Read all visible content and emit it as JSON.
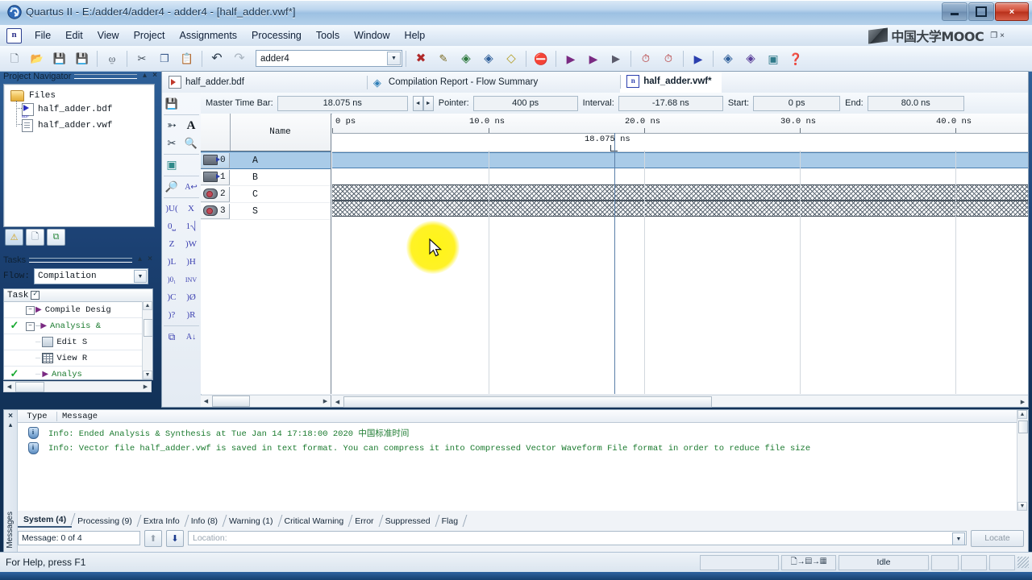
{
  "window": {
    "title": "Quartus II - E:/adder4/adder4 - adder4 - [half_adder.vwf*]",
    "minimize": "minimize-icon",
    "maximize": "maximize-icon",
    "close": "×"
  },
  "menubar": {
    "app_icon": "Ո",
    "items": [
      "File",
      "Edit",
      "View",
      "Project",
      "Assignments",
      "Processing",
      "Tools",
      "Window",
      "Help"
    ],
    "mooc_text": "中国大学MOOC",
    "mooc_restore": "❐",
    "mooc_close": "×"
  },
  "toolbar": {
    "project_value": "adder4",
    "dropdown_arrow": "▼",
    "buttons": [
      {
        "name": "new-file-icon",
        "glyph": "🗋",
        "color": "#56636f"
      },
      {
        "name": "open-file-icon",
        "glyph": "📂",
        "color": "#c8991f"
      },
      {
        "name": "save-icon",
        "glyph": "💾",
        "color": "#4c5b2e"
      },
      {
        "name": "save-all-icon",
        "glyph": "💾",
        "color": "#7a6a22"
      },
      {
        "name": "print-icon",
        "glyph": "⎙",
        "color": "#46525e"
      },
      {
        "name": "cut-icon",
        "glyph": "✂",
        "color": "#3f4b57"
      },
      {
        "name": "copy-icon",
        "glyph": "❐",
        "color": "#3a5b8c"
      },
      {
        "name": "paste-icon",
        "glyph": "📋",
        "color": "#7a8592"
      },
      {
        "name": "undo-icon",
        "glyph": "↶",
        "color": "#2b3b4b"
      },
      {
        "name": "redo-icon",
        "glyph": "↷",
        "color": "#aab5c0"
      },
      {
        "name": "assignment-editor-icon",
        "glyph": "✖",
        "color": "#b02a2a"
      },
      {
        "name": "pin-planner-icon",
        "glyph": "✎",
        "color": "#7a6a22"
      },
      {
        "name": "compile-check-icon",
        "glyph": "◈",
        "color": "#2f7a3f"
      },
      {
        "name": "settings-icon",
        "glyph": "◈",
        "color": "#2f5f9a"
      },
      {
        "name": "programmer-icon",
        "glyph": "◇",
        "color": "#b4a02a"
      },
      {
        "name": "stop-icon",
        "glyph": "⛔",
        "color": "#9aa5b0"
      },
      {
        "name": "start-compilation-icon",
        "glyph": "▶",
        "color": "#7a2a82"
      },
      {
        "name": "start-analysis-icon",
        "glyph": "▶",
        "color": "#7a2a82"
      },
      {
        "name": "analysis-synthesis-icon",
        "glyph": "▶",
        "color": "#5a5a6a"
      },
      {
        "name": "timing-analyzer-icon",
        "glyph": "⏱",
        "color": "#b02a2a"
      },
      {
        "name": "stop-timer-icon",
        "glyph": "⏱",
        "color": "#b02a2a"
      },
      {
        "name": "simulation-icon",
        "glyph": "▶",
        "color": "#2b3fae"
      },
      {
        "name": "rtl-viewer-icon",
        "glyph": "◈",
        "color": "#2f5f9a"
      },
      {
        "name": "technology-map-icon",
        "glyph": "◈",
        "color": "#5a3f9a"
      },
      {
        "name": "chip-planner-icon",
        "glyph": "▣",
        "color": "#2f7a8a"
      },
      {
        "name": "help-icon",
        "glyph": "?",
        "color": "#2b3fae"
      }
    ]
  },
  "project_navigator": {
    "title": "Project Navigator",
    "pin": "▴",
    "close": "×",
    "root": "Files",
    "files": [
      "half_adder.bdf",
      "half_adder.vwf"
    ],
    "tabs": [
      {
        "name": "hierarchy-tab",
        "glyph": "⚠"
      },
      {
        "name": "files-tab",
        "glyph": "🗋"
      },
      {
        "name": "design-units-tab",
        "glyph": "⧉"
      }
    ]
  },
  "tasks": {
    "title": "Tasks",
    "pin": "▴",
    "close": "×",
    "flow_label": "Flow:",
    "flow_value": "Compilation",
    "header": "Task",
    "rows": [
      {
        "check": "",
        "expand": "−",
        "label": "Compile Desig",
        "indent": 1
      },
      {
        "check": "✓",
        "expand": "−",
        "label": "Analysis &",
        "indent": 2
      },
      {
        "check": "",
        "expand": "",
        "label": "Edit S",
        "indent": 3,
        "icon": "square"
      },
      {
        "check": "",
        "expand": "",
        "label": "View R",
        "indent": 3,
        "icon": "grid"
      },
      {
        "check": "✓",
        "expand": "",
        "label": "Analys",
        "indent": 3
      },
      {
        "check": "",
        "expand": "−",
        "label": "",
        "indent": 2
      }
    ]
  },
  "document_tabs": [
    {
      "label": "half_adder.bdf",
      "icon": "bdf-file-icon",
      "active": false
    },
    {
      "label": "Compilation Report - Flow Summary",
      "icon": "report-icon",
      "active": false
    },
    {
      "label": "half_adder.vwf*",
      "icon": "vwf-file-icon",
      "active": true
    }
  ],
  "waveform_tools": [
    {
      "name": "save-waveform-icon",
      "glyph": "💾"
    },
    {
      "name": "selection-tool-icon",
      "glyph": "➳"
    },
    {
      "name": "text-tool-icon",
      "glyph": "A"
    },
    {
      "name": "waveform-editing-tool-icon",
      "glyph": "✄"
    },
    {
      "name": "zoom-tool-icon",
      "glyph": "🔍"
    },
    {
      "name": "fit-in-window-icon",
      "glyph": "▣"
    },
    {
      "name": "find-icon",
      "glyph": "🔍"
    },
    {
      "name": "replace-icon",
      "glyph": "A"
    },
    {
      "name": "uninitialized-icon",
      "glyph": "U"
    },
    {
      "name": "unknown-icon",
      "glyph": "X"
    },
    {
      "name": "forcing-low-icon",
      "glyph": "0"
    },
    {
      "name": "forcing-high-icon",
      "glyph": "1"
    },
    {
      "name": "high-impedance-icon",
      "glyph": "Z"
    },
    {
      "name": "weak-unknown-icon",
      "glyph": "W"
    },
    {
      "name": "weak-low-icon",
      "glyph": "L"
    },
    {
      "name": "weak-high-icon",
      "glyph": "H"
    },
    {
      "name": "count-value-icon",
      "glyph": "C"
    },
    {
      "name": "invert-icon",
      "glyph": "INV"
    },
    {
      "name": "clock-icon",
      "glyph": "C"
    },
    {
      "name": "random-icon",
      "glyph": "Ø"
    },
    {
      "name": "arbitrary-value-icon",
      "glyph": "?"
    },
    {
      "name": "overwrite-icon",
      "glyph": "R"
    },
    {
      "name": "grouping-icon",
      "glyph": "⧉"
    },
    {
      "name": "sort-icon",
      "glyph": "A↓"
    }
  ],
  "time_bar": {
    "master_label": "Master Time Bar:",
    "master_value": "18.075 ns",
    "spin_left": "◄",
    "spin_right": "►",
    "pointer_label": "Pointer:",
    "pointer_value": "400 ps",
    "interval_label": "Interval:",
    "interval_value": "-17.68 ns",
    "start_label": "Start:",
    "start_value": "0 ps",
    "end_label": "End:",
    "end_value": "80.0 ns"
  },
  "waveform": {
    "name_header": "Name",
    "cursor_label": "18.075 ns",
    "ruler_ticks": [
      "0 ps",
      "10.0 ns",
      "20.0 ns",
      "30.0 ns",
      "40.0 ns"
    ],
    "signals": [
      {
        "index": "0",
        "name": "A",
        "kind": "input",
        "state": "selected"
      },
      {
        "index": "1",
        "name": "B",
        "kind": "input",
        "state": "normal"
      },
      {
        "index": "2",
        "name": "C",
        "kind": "output",
        "state": "hatched"
      },
      {
        "index": "3",
        "name": "S",
        "kind": "output",
        "state": "hatched"
      }
    ]
  },
  "messages": {
    "close": "×",
    "pin": "▴",
    "side_label": "Messages",
    "columns": [
      "Type",
      "Message"
    ],
    "rows": [
      {
        "icon": "info-icon",
        "text": "Info: Ended Analysis & Synthesis at Tue Jan 14 17:18:00 2020 中国标准时间"
      },
      {
        "icon": "info-icon",
        "text": "Info: Vector file half_adder.vwf is saved in text format. You can compress it into Compressed Vector Waveform File format in order to reduce file size"
      }
    ],
    "tabs": [
      {
        "label": "System (4)",
        "active": true
      },
      {
        "label": "Processing (9)",
        "active": false
      },
      {
        "label": "Extra Info",
        "active": false
      },
      {
        "label": "Info (8)",
        "active": false
      },
      {
        "label": "Warning (1)",
        "active": false
      },
      {
        "label": "Critical Warning",
        "active": false
      },
      {
        "label": "Error",
        "active": false
      },
      {
        "label": "Suppressed",
        "active": false
      },
      {
        "label": "Flag",
        "active": false
      }
    ],
    "count": "Message: 0 of 4",
    "prev_icon": "⬆",
    "next_icon": "⬇",
    "location_placeholder": "Location:",
    "locate_button": "Locate"
  },
  "status_bar": {
    "help_text": "For Help, press F1",
    "progress_icon": "🗋→▤→▦",
    "state": "Idle"
  },
  "colors": {
    "accent": "#2b3fae",
    "selection": "#a9cbe8",
    "message_green": "#1a7a2e",
    "cursor_highlight": "#fff400",
    "title_gradient_start": "#dceaf7"
  }
}
